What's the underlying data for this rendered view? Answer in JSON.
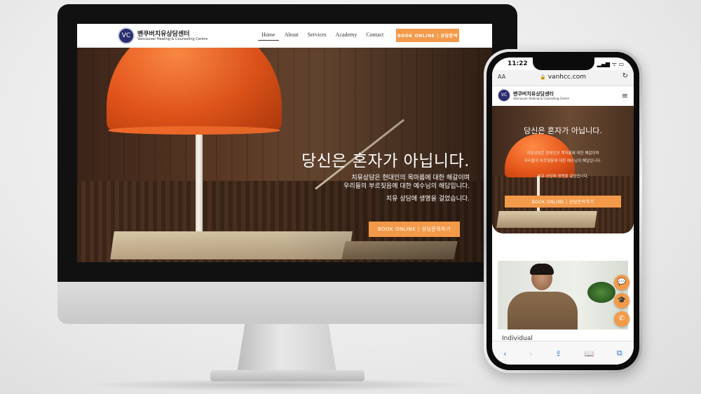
{
  "desktop": {
    "brand": {
      "logo_text": "VC",
      "name_ko": "밴쿠버치유상담센터",
      "name_en": "Vancouver Healing & Counseling Centre"
    },
    "nav": [
      {
        "label": "Home",
        "active": true
      },
      {
        "label": "About",
        "active": false
      },
      {
        "label": "Services",
        "active": false
      },
      {
        "label": "Academy",
        "active": false
      },
      {
        "label": "Contact",
        "active": false
      }
    ],
    "book_button": "BOOK ONLINE  |  상담문의",
    "hero": {
      "title": "당신은 혼자가 아닙니다.",
      "line1": "치유상담은 현대인의 목마름에 대한 해갈이며",
      "line2": "우리들의 부르짖음에 대한 예수님의 해답입니다.",
      "line3": "치유 상담에 생명을 걸었습니다.",
      "button": "BOOK ONLINE  |  상담문의하기"
    }
  },
  "phone": {
    "time": "11:22",
    "status": "▂▄▆ ᯤ ▭",
    "url": "vanhcc.com",
    "aa": "AA",
    "reload": "↻",
    "lock": "🔒",
    "brand": {
      "logo_text": "VC",
      "name_ko": "밴쿠버치유상담센터",
      "name_en": "Vancouver Healing & Counseling Centre"
    },
    "menu_icon": "≡",
    "hero": {
      "title": "당신은 혼자가 아닙니다.",
      "line1": "치유상담은 현대인의 목마름에 대한 해갈이며",
      "line2": "우리들의 부르짖음에 대한 예수님의 해답입니다.",
      "line3": "치유 상담에 생명을 걸었습니다.",
      "button": "BOOK ONLINE  |  상담문의하기"
    },
    "caption": "Individual",
    "floating_icons": [
      "chat-icon",
      "graduation-cap-icon",
      "phone-icon"
    ],
    "floating_glyphs": [
      "💬",
      "🎓",
      "✆"
    ],
    "toolbar": [
      "‹",
      "›",
      "⇪",
      "📖",
      "⧉"
    ]
  },
  "colors": {
    "accent": "#f39a4a",
    "navy": "#2c2f6e"
  }
}
